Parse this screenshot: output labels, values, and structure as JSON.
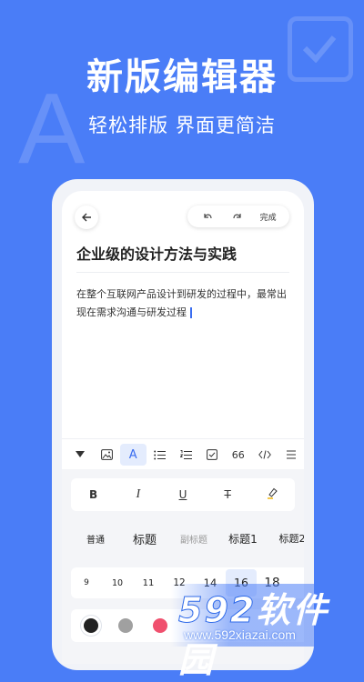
{
  "hero": {
    "title": "新版编辑器",
    "subtitle": "轻松排版 界面更简洁"
  },
  "editor": {
    "done_label": "完成",
    "doc_title": "企业级的设计方法与实践",
    "doc_body": "在整个互联网产品设计到研发的过程中，最常出现在需求沟通与研发过程"
  },
  "toolbar": {
    "items": [
      {
        "icon": "dropdown-triangle-icon"
      },
      {
        "icon": "image-icon"
      },
      {
        "icon": "text-style-icon",
        "label": "A",
        "active": true
      },
      {
        "icon": "bullet-list-icon"
      },
      {
        "icon": "numbered-list-icon"
      },
      {
        "icon": "checkbox-icon"
      },
      {
        "icon": "quote-icon",
        "label": "66"
      },
      {
        "icon": "code-icon"
      },
      {
        "icon": "more-icon"
      }
    ]
  },
  "format": {
    "bold": "B",
    "italic": "I",
    "underline": "U",
    "strike": "T"
  },
  "styles": [
    "普通",
    "标题",
    "副标题",
    "标题1",
    "标题2"
  ],
  "sizes": [
    "9",
    "10",
    "11",
    "12",
    "14",
    "16",
    "18"
  ],
  "selected_size": "16",
  "colors": [
    "#222222",
    "#a0a0a0",
    "#f0506e"
  ],
  "selected_color": "#222222",
  "watermark": {
    "logo_num": "592",
    "logo_cn": "软件园",
    "url": "www.592xiazai.com"
  },
  "theme": {
    "background": "#4a7df7",
    "accent": "#3a6df0"
  }
}
